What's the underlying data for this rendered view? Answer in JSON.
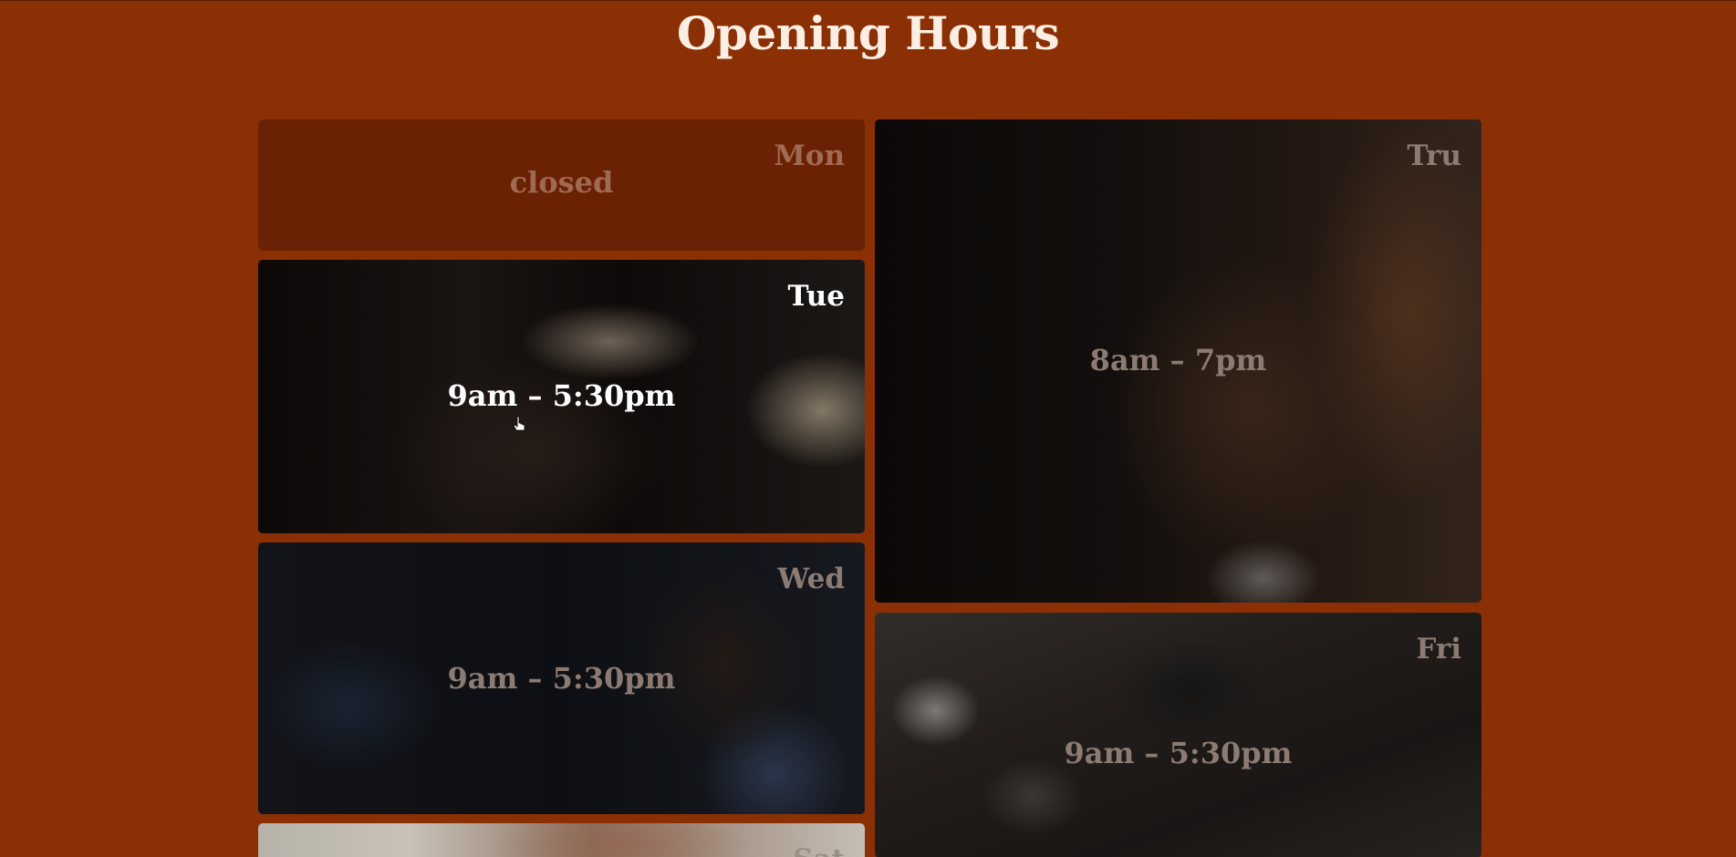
{
  "page": {
    "title": "Opening Hours"
  },
  "days": {
    "mon": {
      "label": "Mon",
      "hours": "closed"
    },
    "tue": {
      "label": "Tue",
      "hours": "9am – 5:30pm"
    },
    "thu": {
      "label": "Tru",
      "hours": "8am – 7pm"
    },
    "wed": {
      "label": "Wed",
      "hours": "9am – 5:30pm"
    },
    "fri": {
      "label": "Fri",
      "hours": "9am – 5:30pm"
    },
    "sat": {
      "label": "Sat"
    }
  },
  "colors": {
    "background": "#8b3005",
    "closed_card": "#6b2204",
    "title_text": "#fbeee3"
  }
}
